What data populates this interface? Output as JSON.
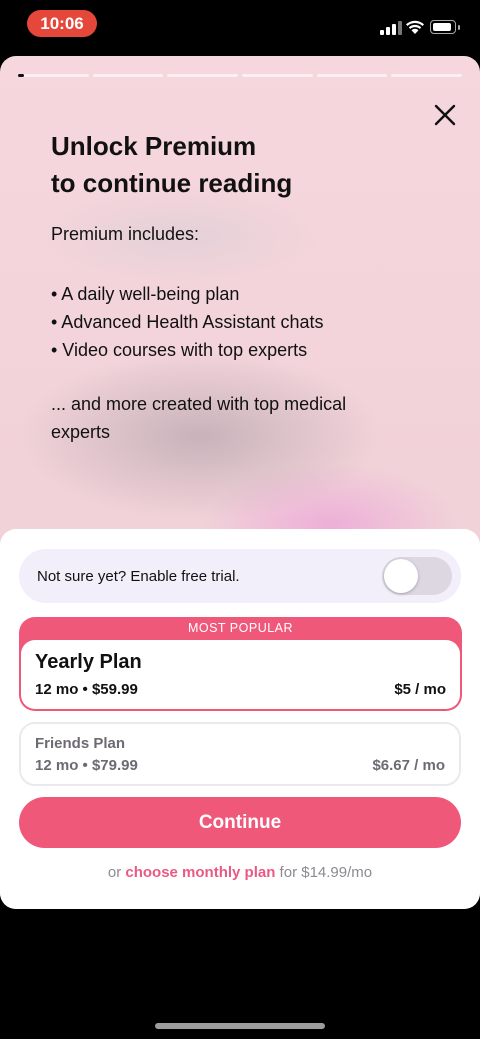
{
  "status_bar": {
    "time": "10:06",
    "time_pill_color": "#e5473a"
  },
  "paywall": {
    "progress_segments": 6,
    "active_segment": 0,
    "headline_line1": "Unlock Premium",
    "headline_line2": "to continue reading",
    "includes_title": "Premium includes:",
    "features": [
      "• A daily well-being plan",
      "• Advanced Health Assistant chats",
      "• Video courses with top experts"
    ],
    "more_text": "... and more created with top medical experts"
  },
  "trial": {
    "label": "Not sure yet? Enable free trial.",
    "enabled": false
  },
  "plans": {
    "popular_badge": "MOST POPULAR",
    "yearly": {
      "name": "Yearly Plan",
      "term": "12 mo • $59.99",
      "price": "$5 / mo",
      "selected": true
    },
    "friends": {
      "name": "Friends Plan",
      "term": "12 mo • $79.99",
      "price": "$6.67 / mo",
      "selected": false
    }
  },
  "actions": {
    "continue_label": "Continue",
    "monthly_prefix": "or ",
    "monthly_link": "choose monthly plan",
    "monthly_suffix": " for $14.99/mo"
  },
  "colors": {
    "accent": "#f0587a",
    "link": "#e95a85",
    "trial_bg": "#f3effa"
  }
}
